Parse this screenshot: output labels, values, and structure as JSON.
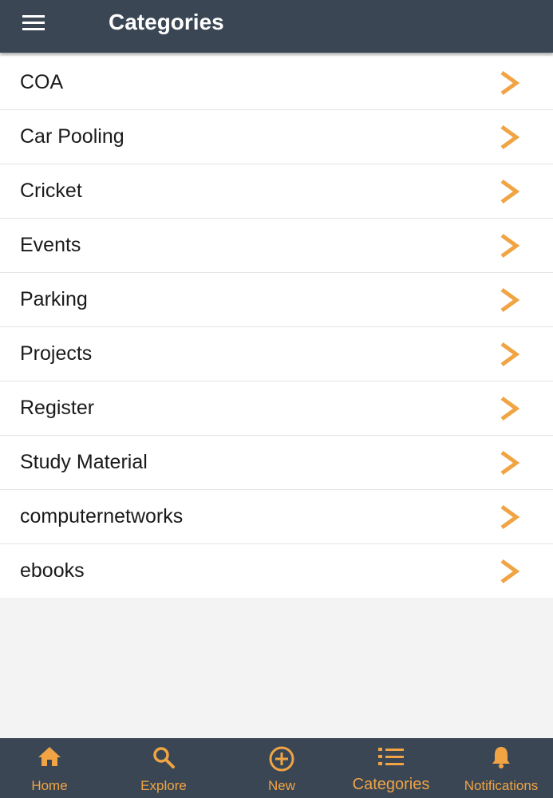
{
  "header": {
    "title": "Categories",
    "menu_icon": "hamburger-icon"
  },
  "categories": [
    {
      "label": "COA"
    },
    {
      "label": "Car Pooling"
    },
    {
      "label": "Cricket"
    },
    {
      "label": "Events"
    },
    {
      "label": "Parking"
    },
    {
      "label": "Projects"
    },
    {
      "label": "Register"
    },
    {
      "label": "Study Material"
    },
    {
      "label": "computernetworks"
    },
    {
      "label": "ebooks"
    }
  ],
  "bottom_nav": {
    "items": [
      {
        "label": "Home",
        "icon": "home-icon"
      },
      {
        "label": "Explore",
        "icon": "search-icon"
      },
      {
        "label": "New",
        "icon": "plus-circle-icon"
      },
      {
        "label": "Categories",
        "icon": "list-icon"
      },
      {
        "label": "Notifications",
        "icon": "bell-icon"
      }
    ]
  },
  "colors": {
    "app_bar": "#3a4654",
    "accent": "#f0a444",
    "list_background": "#ffffff",
    "page_background": "#f3f3f3"
  }
}
